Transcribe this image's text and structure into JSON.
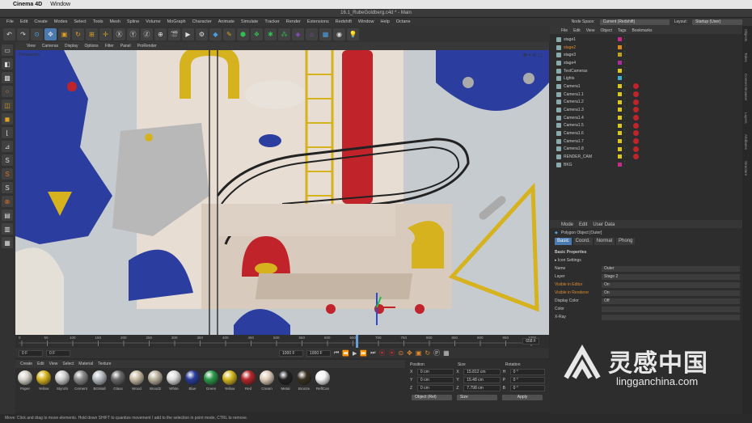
{
  "mac_menu": {
    "app": "Cinema 4D",
    "window": "Window"
  },
  "title": "16.1_RubeGoldberg.c4d * - Main",
  "menus": [
    "File",
    "Edit",
    "Create",
    "Modes",
    "Select",
    "Tools",
    "Mesh",
    "Spline",
    "Volume",
    "MoGraph",
    "Character",
    "Animate",
    "Simulate",
    "Tracker",
    "Render",
    "Extensions",
    "Redshift",
    "Window",
    "Help",
    "Octane"
  ],
  "node_space": {
    "label": "Node Space:",
    "value": "Current (Redshift)"
  },
  "layout": {
    "label": "Layout:",
    "value": "Startup (User)"
  },
  "viewport_menu": [
    "View",
    "Cameras",
    "Display",
    "Options",
    "Filter",
    "Panel",
    "ProRender"
  ],
  "viewport_label": "Perspective",
  "timeline_ticks": [
    "0",
    "50",
    "100",
    "150",
    "200",
    "250",
    "300",
    "350",
    "400",
    "450",
    "500",
    "550",
    "600",
    "650",
    "700",
    "750",
    "800",
    "850",
    "900",
    "950",
    "1000"
  ],
  "frame_readout": "658 F",
  "transport": {
    "start": "0 F",
    "current": "0 F",
    "end": "1000 F",
    "max": "1000 F"
  },
  "material_menu": [
    "Create",
    "Edit",
    "View",
    "Select",
    "Material",
    "Texture"
  ],
  "materials": [
    {
      "name": "Paper",
      "color": "#d8d4cc"
    },
    {
      "name": "Yellow",
      "color": "#d8b420"
    },
    {
      "name": "Styrofo",
      "color": "#cfcfcf"
    },
    {
      "name": "Cement",
      "color": "#8a8a8a"
    },
    {
      "name": "BGWall",
      "color": "#b9bec3"
    },
    {
      "name": "Glass",
      "color": "#6a6a6a"
    },
    {
      "name": "Wood",
      "color": "#c8bca5"
    },
    {
      "name": "Wood2",
      "color": "#bab19c"
    },
    {
      "name": "White",
      "color": "#dddddd"
    },
    {
      "name": "Blue",
      "color": "#283c9a"
    },
    {
      "name": "Green",
      "color": "#2a9a4a"
    },
    {
      "name": "Yellow",
      "color": "#d6b81e"
    },
    {
      "name": "Red",
      "color": "#b8262a"
    },
    {
      "name": "Cream",
      "color": "#e0cdbb"
    },
    {
      "name": "Metal",
      "color": "#222222"
    },
    {
      "name": "Bronze",
      "color": "#3a3020"
    },
    {
      "name": "ReflCan",
      "color": "#f4f4f4"
    }
  ],
  "coords": {
    "headers": [
      "Position",
      "Size",
      "Rotation"
    ],
    "rows": [
      {
        "axis": "X",
        "pos": "0 cm",
        "size_axis": "X",
        "size": "15.812 cm",
        "rot_axis": "H",
        "rot": "0 °"
      },
      {
        "axis": "Y",
        "pos": "0 cm",
        "size_axis": "Y",
        "size": "15.48 cm",
        "rot_axis": "P",
        "rot": "0 °"
      },
      {
        "axis": "Z",
        "pos": "0 cm",
        "size_axis": "Z",
        "size": "7.798 cm",
        "rot_axis": "B",
        "rot": "0 °"
      }
    ],
    "mode": "Object (Rel)",
    "size_mode": "Size",
    "apply": "Apply"
  },
  "obj_menu": [
    "File",
    "Edit",
    "View",
    "Object",
    "Tags",
    "Bookmarks"
  ],
  "objects": [
    {
      "name": "stage1",
      "color": "#c72a8a",
      "cam": false
    },
    {
      "name": "stage2",
      "color": "#d88a20",
      "cam": false,
      "selected": true
    },
    {
      "name": "stage3",
      "color": "#c0a020",
      "cam": false
    },
    {
      "name": "stage4",
      "color": "#b02aa0",
      "cam": false
    },
    {
      "name": "TestCameras",
      "color": "#d8c820",
      "cam": false
    },
    {
      "name": "Lights",
      "color": "#3ab0d0",
      "cam": false
    },
    {
      "name": "Camera1",
      "color": "#d8c820",
      "cam": true
    },
    {
      "name": "Camera1.1",
      "color": "#d8c820",
      "cam": true
    },
    {
      "name": "Camera1.2",
      "color": "#d8c820",
      "cam": true
    },
    {
      "name": "Camera1.3",
      "color": "#d8c820",
      "cam": true
    },
    {
      "name": "Camera1.4",
      "color": "#d8c820",
      "cam": true
    },
    {
      "name": "Camera1.5",
      "color": "#d8c820",
      "cam": true
    },
    {
      "name": "Camera1.6",
      "color": "#d8c820",
      "cam": true
    },
    {
      "name": "Camera1.7",
      "color": "#d8c820",
      "cam": true
    },
    {
      "name": "Camera1.8",
      "color": "#d8c820",
      "cam": true
    },
    {
      "name": "RENDER_CAM",
      "color": "#d8c820",
      "cam": true
    },
    {
      "name": "BKG",
      "color": "#c72a8a",
      "cam": false
    }
  ],
  "attr": {
    "menu": [
      "Mode",
      "Edit",
      "User Data"
    ],
    "object_title": "Polygon Object [Outer]",
    "tabs": [
      "Basic",
      "Coord.",
      "Normal",
      "Phong"
    ],
    "section": "Basic Properties",
    "icon_settings": "▸ Icon Settings",
    "fields": [
      {
        "label": "Name",
        "value": "Outer"
      },
      {
        "label": "Layer",
        "value": "Stage 2"
      },
      {
        "label": "Visible in Editor",
        "value": "On",
        "accent": true
      },
      {
        "label": "Visible in Renderer",
        "value": "On",
        "accent": true
      },
      {
        "label": "Display Color",
        "value": "Off"
      },
      {
        "label": "Color",
        "value": ""
      },
      {
        "label": "X-Ray",
        "value": ""
      }
    ]
  },
  "right_tabs": [
    "Objects",
    "Takes",
    "Content Browser",
    "Layers",
    "Attributes",
    "Structure"
  ],
  "status": "Move: Click and drag to move elements. Hold down SHIFT to quantize movement / add to the selection in point mode, CTRL to remove.",
  "watermark": {
    "cn": "灵感中国",
    "en": "lingganchina.com"
  },
  "colors": {
    "accent": "#e8c020",
    "selected_text": "#e08a30",
    "blue": "#2b3d9e",
    "red": "#c0242a",
    "yellow": "#d6b31e"
  }
}
